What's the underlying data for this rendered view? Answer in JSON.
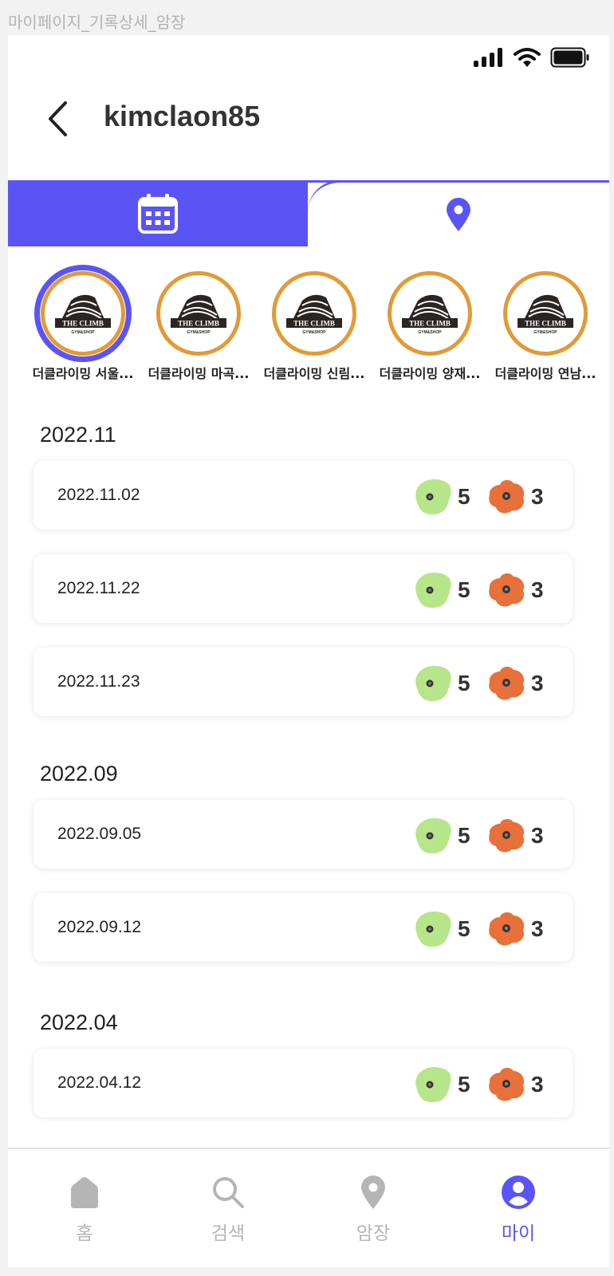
{
  "frame_label": "마이페이지_기록상세_암장",
  "header": {
    "title": "kimclaon85"
  },
  "tabs": [
    "calendar-view",
    "location-view"
  ],
  "gyms": [
    {
      "name": "더클라이밍 서울...",
      "selected": true
    },
    {
      "name": "더클라이밍 마곡...",
      "selected": false
    },
    {
      "name": "더클라이밍 신림...",
      "selected": false
    },
    {
      "name": "더클라이밍 양재...",
      "selected": false
    },
    {
      "name": "더클라이밍 연남...",
      "selected": false
    }
  ],
  "logo_text": {
    "main": "THE CLIMB",
    "sub": "GYM&SHOP"
  },
  "months": [
    {
      "label": "2022.11",
      "records": [
        {
          "date": "2022.11.02",
          "green": "5",
          "orange": "3"
        },
        {
          "date": "2022.11.22",
          "green": "5",
          "orange": "3"
        },
        {
          "date": "2022.11.23",
          "green": "5",
          "orange": "3"
        }
      ]
    },
    {
      "label": "2022.09",
      "records": [
        {
          "date": "2022.09.05",
          "green": "5",
          "orange": "3"
        },
        {
          "date": "2022.09.12",
          "green": "5",
          "orange": "3"
        }
      ]
    },
    {
      "label": "2022.04",
      "records": [
        {
          "date": "2022.04.12",
          "green": "5",
          "orange": "3"
        }
      ]
    }
  ],
  "nav": [
    {
      "label": "홈",
      "icon": "home-icon",
      "active": false
    },
    {
      "label": "검색",
      "icon": "search-icon",
      "active": false
    },
    {
      "label": "암장",
      "icon": "location-pin-icon",
      "active": false
    },
    {
      "label": "마이",
      "icon": "user-icon",
      "active": true
    }
  ],
  "colors": {
    "accent": "#5b54f5",
    "gym_ring": "#e39a35",
    "hold_green": "#b7e58a",
    "hold_orange": "#e8703a",
    "nav_inactive": "#b5b5b5"
  }
}
